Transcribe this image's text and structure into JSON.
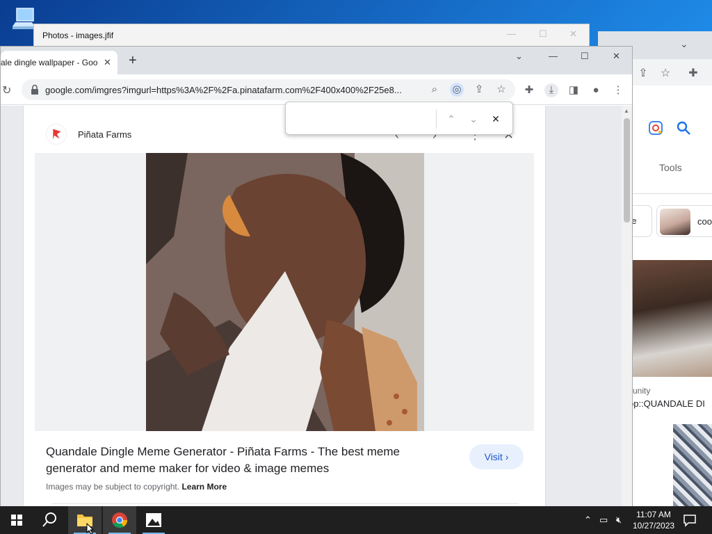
{
  "desktop": {
    "icon_label": "This PC"
  },
  "photos_window": {
    "title": "Photos - images.jfif"
  },
  "browser": {
    "tab_title": "ale dingle wallpaper - Goo",
    "tab_close": "✕",
    "new_tab": "+",
    "url": "google.com/imgres?imgurl=https%3A%2F%2Fa.pinatafarm.com%2F400x400%2F25e8...",
    "minimize": "—",
    "maximize": "☐",
    "close": "✕",
    "chevron": "⌄"
  },
  "find_bar": {
    "value": "",
    "prev": "⌃",
    "next": "⌄",
    "close": "✕"
  },
  "panel": {
    "source_name": "Piñata Farms",
    "result_title": "Quandale Dingle Meme Generator - Piñata Farms - The best meme generator and meme maker for video & image memes",
    "visit_label": "Visit",
    "copyright_text": "Images may be subject to copyright.",
    "learn_more": "Learn More",
    "share_label": "Share"
  },
  "background_window": {
    "tools_label": "Tools",
    "chip1_text": "ne",
    "chip2_text": "coo",
    "result_source": "unity",
    "result_title": "op::QUANDALE DI"
  },
  "taskbar": {
    "time": "11:07 AM",
    "date": "10/27/2023"
  },
  "colors": {
    "accent": "#1a73e8",
    "visit_bg": "#e8f0fe",
    "taskbar": "#1f1f1f"
  }
}
